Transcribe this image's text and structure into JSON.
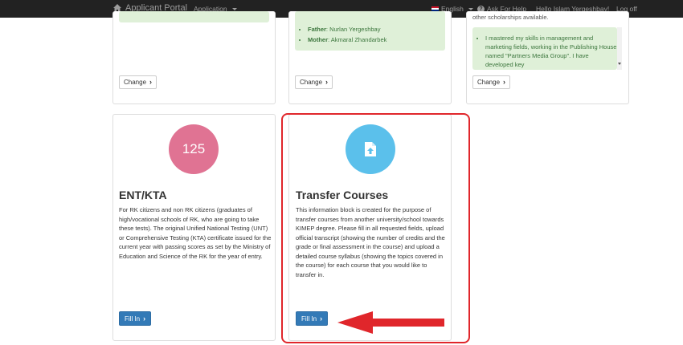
{
  "navbar": {
    "brand": "Applicant Portal",
    "menu_application": "Application",
    "language": "English",
    "help": "Ask For Help",
    "greeting": "Hello Islam Yergeshbay!",
    "logout": "Log off"
  },
  "top_cards": {
    "card2": {
      "items": [
        {
          "label": "Father",
          "value": ": Nurlan Yergeshbay"
        },
        {
          "label": "Mother",
          "value": ": Akmaral Zhandarbek"
        }
      ],
      "button": "Change"
    },
    "card1": {
      "button": "Change"
    },
    "card3": {
      "top_text": "other scholarships available.",
      "items": [
        "I mastered my skills in management and marketing fields, working in the Publishing House named \"Partners Media Group\". I have developed key"
      ],
      "button": "Change"
    }
  },
  "ent_card": {
    "score": "125",
    "title": "ENT/KTA",
    "description": "For RK citizens and non RK citizens (graduates of high/vocational schools of RK, who are going to take these tests). The original Unified National Testing (UNT) or Comprehensive Testing (KTA) certificate issued for the current year with passing scores as set by the Ministry of Education and Science of the RK for the year of entry.",
    "button": "Fill In",
    "color": "#e07393"
  },
  "transfer_card": {
    "title": "Transfer Courses",
    "description": "This information block is created for the purpose of transfer courses from another university/school towards KIMEP degree. Please fill in all requested fields, upload official transcript (showing the number of credits and the grade or final assessment in the course) and upload a detailed course syllabus (showing the topics covered in the course) for each course that you would like to transfer in.",
    "button": "Fill In",
    "icon_color": "#5bc0eb"
  },
  "colors": {
    "highlight": "#e0262b",
    "primary": "#337ab7",
    "navbar": "#222222"
  }
}
